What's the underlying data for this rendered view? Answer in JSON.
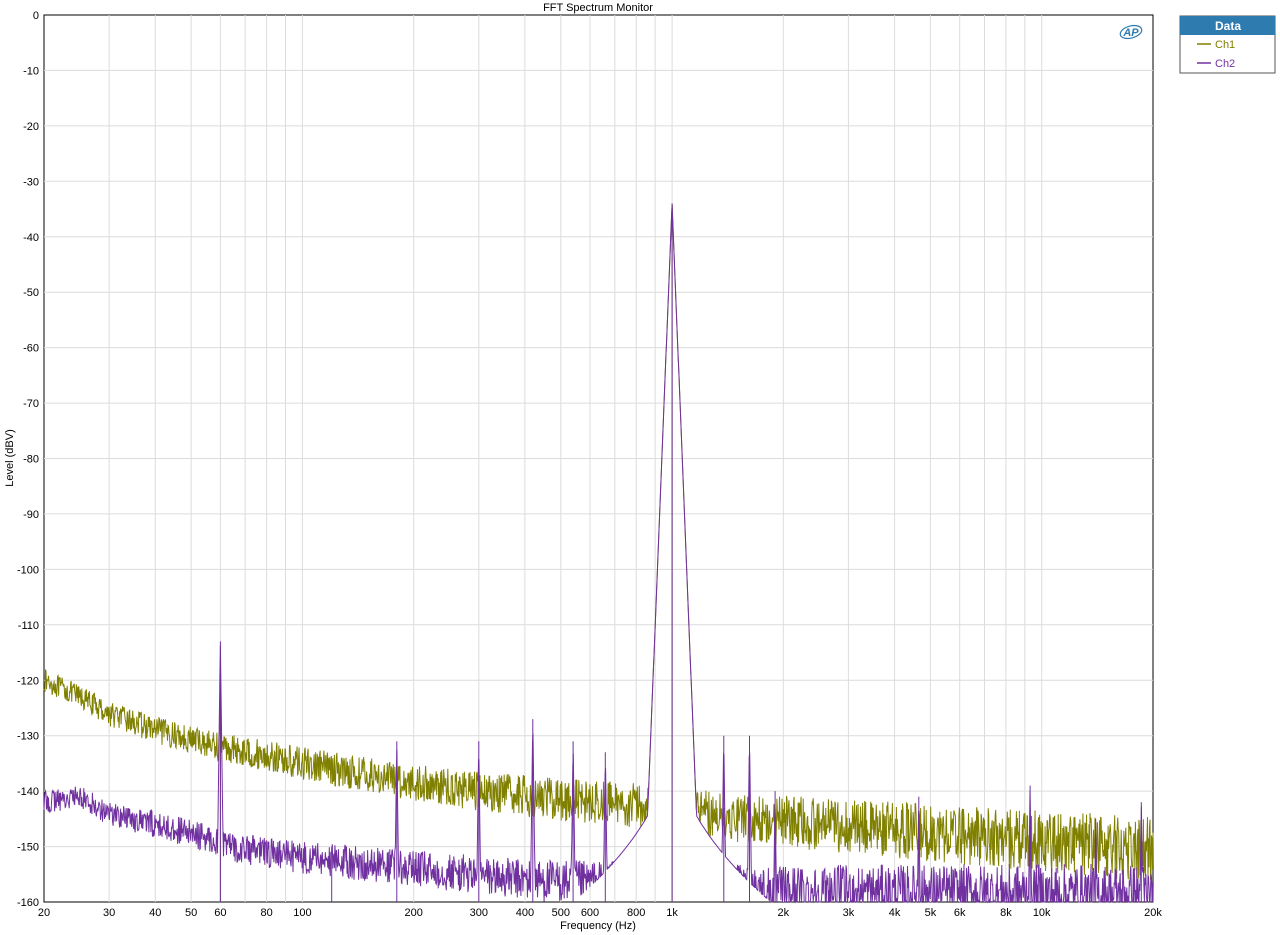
{
  "window": {
    "title": "FFT Spectrum Monitor",
    "logo_text": "AP"
  },
  "legend": {
    "title": "Data",
    "placement": "top-right, outside plot",
    "header_color": "#2e7bb0",
    "items": [
      {
        "label": "Ch1",
        "color": "#808000"
      },
      {
        "label": "Ch2",
        "color": "#7030a0"
      }
    ]
  },
  "chart_data": {
    "type": "line",
    "title": "FFT Spectrum Monitor",
    "xlabel": "Frequency (Hz)",
    "ylabel": "Level (dBV)",
    "xscale": "log",
    "xlim": [
      20,
      20000
    ],
    "ylim": [
      -160,
      0
    ],
    "grid": true,
    "x_ticks": [
      20,
      30,
      40,
      50,
      60,
      80,
      100,
      200,
      300,
      400,
      500,
      600,
      800,
      1000,
      2000,
      3000,
      4000,
      5000,
      6000,
      8000,
      10000,
      20000
    ],
    "x_tick_labels": [
      "20",
      "30",
      "40",
      "50",
      "60",
      "80",
      "100",
      "200",
      "300",
      "400",
      "500",
      "600",
      "800",
      "1k",
      "2k",
      "3k",
      "4k",
      "5k",
      "6k",
      "8k",
      "10k",
      "20k"
    ],
    "y_ticks": [
      0,
      -10,
      -20,
      -30,
      -40,
      -50,
      -60,
      -70,
      -80,
      -90,
      -100,
      -110,
      -120,
      -130,
      -140,
      -150,
      -160
    ],
    "y_tick_labels": [
      "0",
      "-10",
      "-20",
      "-30",
      "-40",
      "-50",
      "-60",
      "-70",
      "-80",
      "-90",
      "-100",
      "-110",
      "-120",
      "-130",
      "-140",
      "-150",
      "-160"
    ],
    "series": [
      {
        "name": "Ch1",
        "color": "#808000",
        "floor": [
          [
            20,
            -120
          ],
          [
            25,
            -123
          ],
          [
            30,
            -126
          ],
          [
            40,
            -129
          ],
          [
            60,
            -132
          ],
          [
            100,
            -135
          ],
          [
            200,
            -138.5
          ],
          [
            300,
            -140
          ],
          [
            500,
            -141.5
          ],
          [
            800,
            -142.5
          ],
          [
            1000,
            -143.5
          ],
          [
            2000,
            -145.5
          ],
          [
            5000,
            -147.5
          ],
          [
            10000,
            -149
          ],
          [
            20000,
            -150.5
          ]
        ],
        "noise_dB": 2.5,
        "peaks": [
          [
            60,
            -120
          ],
          [
            1000,
            -34
          ]
        ]
      },
      {
        "name": "Ch2",
        "color": "#7030a0",
        "floor": [
          [
            20,
            -142
          ],
          [
            25,
            -141
          ],
          [
            30,
            -144
          ],
          [
            40,
            -146
          ],
          [
            59,
            -149
          ],
          [
            62,
            -150
          ],
          [
            100,
            -152
          ],
          [
            200,
            -154
          ],
          [
            400,
            -156
          ],
          [
            900,
            -157
          ],
          [
            2000,
            -158
          ],
          [
            20000,
            -159
          ]
        ],
        "noise_dB": 2.5,
        "peaks": [
          [
            60,
            -113
          ],
          [
            120,
            -150
          ],
          [
            180,
            -131
          ],
          [
            300,
            -131
          ],
          [
            420,
            -127
          ],
          [
            540,
            -131
          ],
          [
            660,
            -133
          ],
          [
            1000,
            -34
          ],
          [
            1380,
            -130
          ],
          [
            1620,
            -130
          ],
          [
            1900,
            -140
          ],
          [
            4650,
            -141
          ],
          [
            9300,
            -139
          ],
          [
            14000,
            -145
          ],
          [
            18600,
            -142
          ]
        ]
      }
    ]
  }
}
